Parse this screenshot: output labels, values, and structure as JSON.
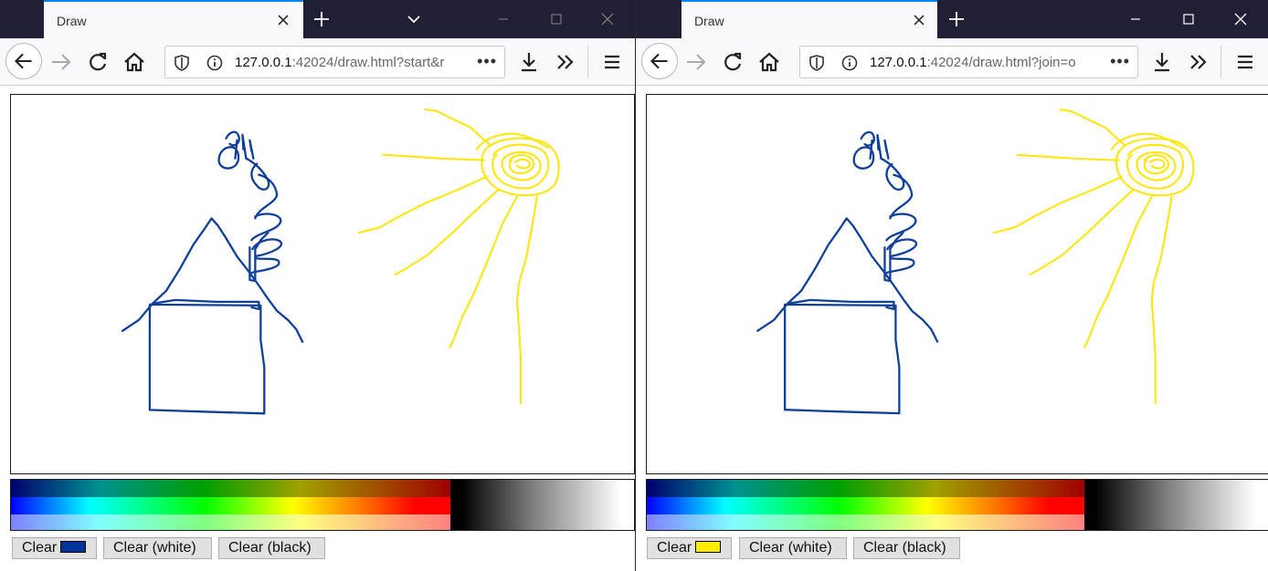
{
  "windows": [
    {
      "tab_title": "Draw",
      "url_host": "127.0.0.1",
      "url_rest": ":42024/draw.html?start&r",
      "url_more": "•••",
      "clear_color_label": "Clear",
      "clear_white_label": "Clear (white)",
      "clear_black_label": "Clear (black)",
      "swatch_color": "#003399"
    },
    {
      "tab_title": "Draw",
      "url_host": "127.0.0.1",
      "url_rest": ":42024/draw.html?join=o",
      "url_more": "•••",
      "clear_color_label": "Clear",
      "clear_white_label": "Clear (white)",
      "clear_black_label": "Clear (black)",
      "swatch_color": "#ffee00"
    }
  ],
  "drawing": {
    "house_color": "#0f3f99",
    "sun_color": "#ffe600"
  },
  "icons": {
    "back": "back-arrow-icon",
    "forward": "forward-arrow-icon",
    "reload": "reload-icon",
    "home": "home-icon",
    "shield": "tracking-shield-icon",
    "info": "info-icon",
    "download": "download-icon",
    "overflow": "overflow-chevrons-icon",
    "menu": "hamburger-menu-icon"
  }
}
